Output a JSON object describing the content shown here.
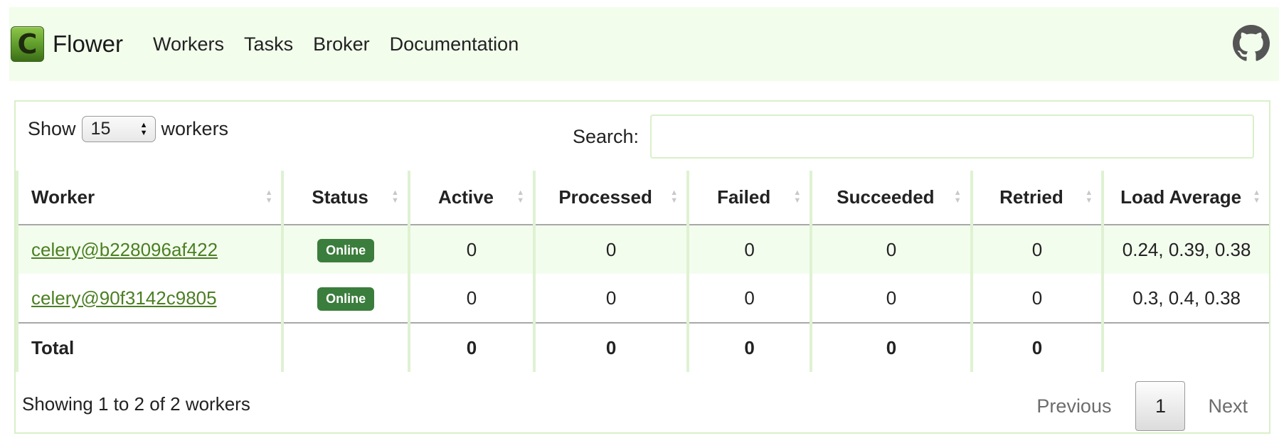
{
  "brand": {
    "name": "Flower",
    "logo_letter": "C"
  },
  "nav": {
    "items": [
      "Workers",
      "Tasks",
      "Broker",
      "Documentation"
    ]
  },
  "github": {
    "icon": "github-icon"
  },
  "table_controls": {
    "show_prefix": "Show",
    "page_length": "15",
    "show_suffix": "workers",
    "search_label": "Search:",
    "search_value": ""
  },
  "table": {
    "columns": [
      "Worker",
      "Status",
      "Active",
      "Processed",
      "Failed",
      "Succeeded",
      "Retried",
      "Load Average"
    ],
    "rows": [
      {
        "worker": "celery@b228096af422",
        "status": "Online",
        "active": "0",
        "processed": "0",
        "failed": "0",
        "succeeded": "0",
        "retried": "0",
        "load_average": "0.24, 0.39, 0.38"
      },
      {
        "worker": "celery@90f3142c9805",
        "status": "Online",
        "active": "0",
        "processed": "0",
        "failed": "0",
        "succeeded": "0",
        "retried": "0",
        "load_average": "0.3, 0.4, 0.38"
      }
    ],
    "total": {
      "label": "Total",
      "active": "0",
      "processed": "0",
      "failed": "0",
      "succeeded": "0",
      "retried": "0",
      "load_average": ""
    }
  },
  "footer": {
    "info": "Showing 1 to 2 of 2 workers",
    "previous": "Previous",
    "current_page": "1",
    "next": "Next"
  },
  "colors": {
    "navbar_bg": "#f2fdec",
    "link": "#4b7f22",
    "badge_online": "#3b7d3c",
    "panel_border": "#d8f0c8"
  }
}
